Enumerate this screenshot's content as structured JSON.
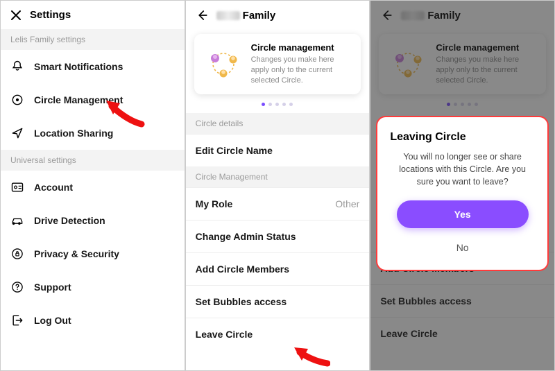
{
  "panel1": {
    "title": "Settings",
    "section1_header": "Lelis Family settings",
    "items1": [
      {
        "label": "Smart Notifications",
        "icon": "bell"
      },
      {
        "label": "Circle Management",
        "icon": "target"
      },
      {
        "label": "Location Sharing",
        "icon": "location"
      }
    ],
    "section2_header": "Universal settings",
    "items2": [
      {
        "label": "Account",
        "icon": "account"
      },
      {
        "label": "Drive Detection",
        "icon": "car"
      },
      {
        "label": "Privacy & Security",
        "icon": "lock"
      },
      {
        "label": "Support",
        "icon": "help"
      },
      {
        "label": "Log Out",
        "icon": "logout"
      }
    ]
  },
  "panel2": {
    "crumb_suffix": "Family",
    "card": {
      "title": "Circle management",
      "subtitle": "Changes you make here apply only to the current selected Circle."
    },
    "section1": "Circle details",
    "row_edit": "Edit Circle Name",
    "section2": "Circle Management",
    "row_role_label": "My Role",
    "row_role_value": "Other",
    "row_admin": "Change Admin Status",
    "row_add": "Add Circle Members",
    "row_bubbles": "Set Bubbles access",
    "row_leave": "Leave Circle"
  },
  "panel3": {
    "crumb_suffix": "Family",
    "card": {
      "title": "Circle management",
      "subtitle": "Changes you make here apply only to the current selected Circle."
    },
    "row_add": "Add Circle Members",
    "row_bubbles": "Set Bubbles access",
    "row_leave": "Leave Circle",
    "dialog": {
      "title": "Leaving Circle",
      "message": "You will no longer see or share locations with this Circle. Are you sure you want to leave?",
      "yes": "Yes",
      "no": "No"
    }
  }
}
